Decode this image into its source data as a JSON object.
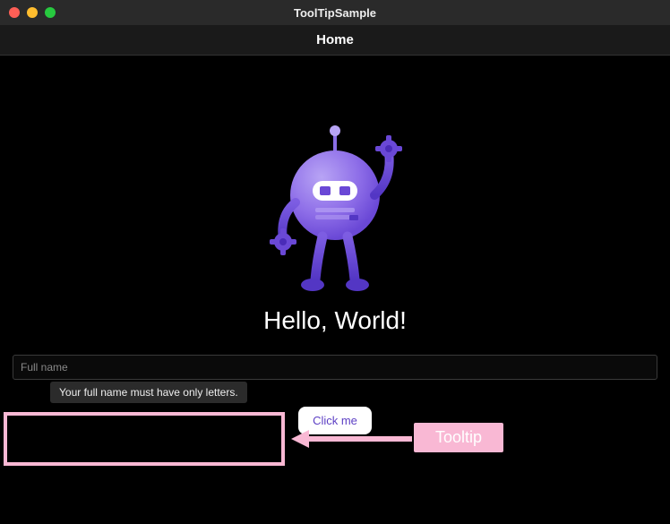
{
  "window": {
    "title": "ToolTipSample"
  },
  "navbar": {
    "title": "Home"
  },
  "main": {
    "heading": "Hello, World!",
    "input_placeholder": "Full name",
    "tooltip_text": "Your full name must have only letters.",
    "button_label": "Click me"
  },
  "annotation": {
    "label": "Tooltip"
  },
  "colors": {
    "accent": "#7c5ce0",
    "annotation": "#f9b8d4"
  }
}
